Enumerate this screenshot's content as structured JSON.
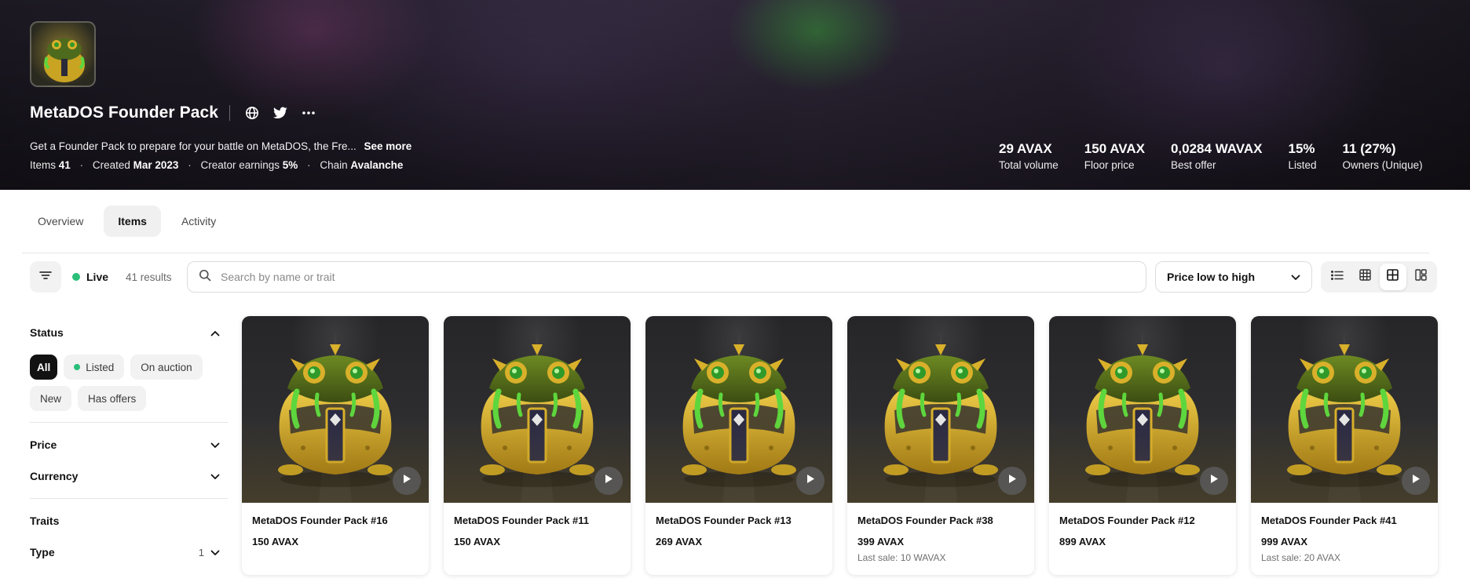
{
  "banner": {
    "title": "MetaDOS Founder Pack",
    "description": "Get a Founder Pack to prepare for your battle on MetaDOS, the Fre...",
    "see_more": "See more",
    "meta": {
      "items_label": "Items",
      "items_value": "41",
      "created_label": "Created",
      "created_value": "Mar 2023",
      "earnings_label": "Creator earnings",
      "earnings_value": "5%",
      "chain_label": "Chain",
      "chain_value": "Avalanche",
      "separator": "·"
    },
    "stats": [
      {
        "value": "29 AVAX",
        "label": "Total volume"
      },
      {
        "value": "150 AVAX",
        "label": "Floor price"
      },
      {
        "value": "0,0284 WAVAX",
        "label": "Best offer"
      },
      {
        "value": "15%",
        "label": "Listed"
      },
      {
        "value": "11 (27%)",
        "label": "Owners (Unique)"
      }
    ]
  },
  "tabs": [
    "Overview",
    "Items",
    "Activity"
  ],
  "active_tab": "Items",
  "toolbar": {
    "live_label": "Live",
    "results": "41 results",
    "search_placeholder": "Search by name or trait",
    "sort_value": "Price low to high"
  },
  "sidebar": {
    "status": {
      "title": "Status",
      "chips": [
        "All",
        "Listed",
        "On auction",
        "New",
        "Has offers"
      ],
      "active": "All"
    },
    "price_title": "Price",
    "currency_title": "Currency",
    "traits_title": "Traits",
    "type_title": "Type",
    "type_count": "1"
  },
  "items": [
    {
      "name": "MetaDOS Founder Pack #16",
      "price": "150 AVAX",
      "last_sale": ""
    },
    {
      "name": "MetaDOS Founder Pack #11",
      "price": "150 AVAX",
      "last_sale": ""
    },
    {
      "name": "MetaDOS Founder Pack #13",
      "price": "269 AVAX",
      "last_sale": ""
    },
    {
      "name": "MetaDOS Founder Pack #38",
      "price": "399 AVAX",
      "last_sale": "Last sale: 10 WAVAX"
    },
    {
      "name": "MetaDOS Founder Pack #12",
      "price": "899 AVAX",
      "last_sale": ""
    },
    {
      "name": "MetaDOS Founder Pack #41",
      "price": "999 AVAX",
      "last_sale": "Last sale: 20 AVAX"
    }
  ],
  "colors": {
    "live_dot": "#2bbf7a",
    "active_chip": "#121212",
    "creature_gold": "#d9b02a",
    "creature_green": "#4fcf35"
  },
  "icons": {
    "website": "globe-icon",
    "twitter": "twitter-icon",
    "more": "more-horizontal-icon",
    "filter": "filter-icon",
    "search": "search-icon",
    "sort": "chevron-down-icon",
    "views": [
      "list-view-icon",
      "grid-small-icon",
      "grid-large-icon",
      "grid-mosaic-icon"
    ],
    "play": "play-icon"
  }
}
